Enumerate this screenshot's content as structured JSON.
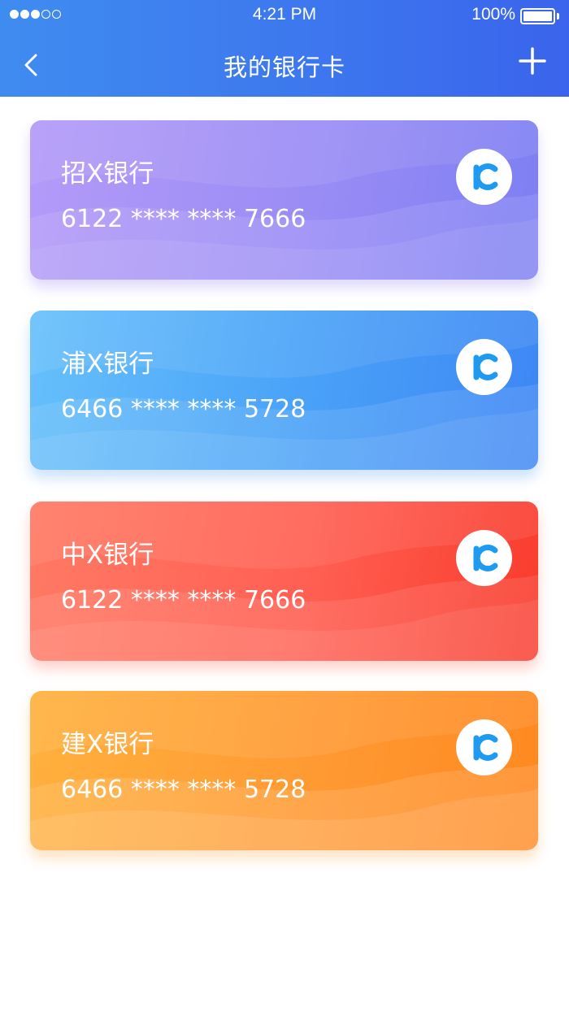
{
  "status_bar": {
    "time": "4:21 PM",
    "battery": "100%",
    "signal_strength": 3,
    "signal_total": 5
  },
  "nav": {
    "title": "我的银行卡",
    "back_icon": "chevron-left-icon",
    "add_icon": "plus-icon"
  },
  "cards": [
    {
      "bank": "招X银行",
      "number": "6122 **** **** 7666",
      "logo_icon": "ic-logo-icon"
    },
    {
      "bank": "浦X银行",
      "number": "6466 **** **** 5728",
      "logo_icon": "ic-logo-icon"
    },
    {
      "bank": "中X银行",
      "number": "6122 **** **** 7666",
      "logo_icon": "ic-logo-icon"
    },
    {
      "bank": "建X银行",
      "number": "6466 **** **** 5728",
      "logo_icon": "ic-logo-icon"
    }
  ],
  "colors": {
    "header": "#3d77ee",
    "logo": "#1e9bf0",
    "card_purple": "#9a8cf5",
    "card_blue": "#4ba4f8",
    "card_red": "#ff5f52",
    "card_orange": "#ff9a33"
  }
}
